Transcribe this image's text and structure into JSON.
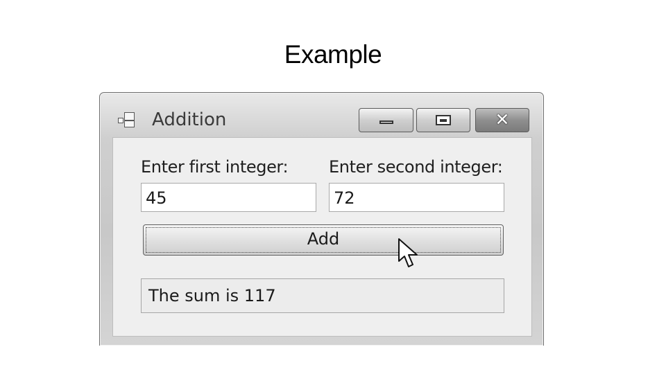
{
  "slide": {
    "title": "Example"
  },
  "window": {
    "title": "Addition",
    "controls": {
      "minimize_icon": "minimize-icon",
      "maximize_icon": "maximize-icon",
      "close_icon": "close-icon"
    }
  },
  "form": {
    "first_label": "Enter first integer:",
    "first_value": "45",
    "second_label": "Enter second integer:",
    "second_value": "72",
    "add_label": "Add",
    "result_text": "The sum is 117"
  },
  "icons": {
    "app": "app-icon",
    "cursor": "mouse-pointer-icon"
  }
}
